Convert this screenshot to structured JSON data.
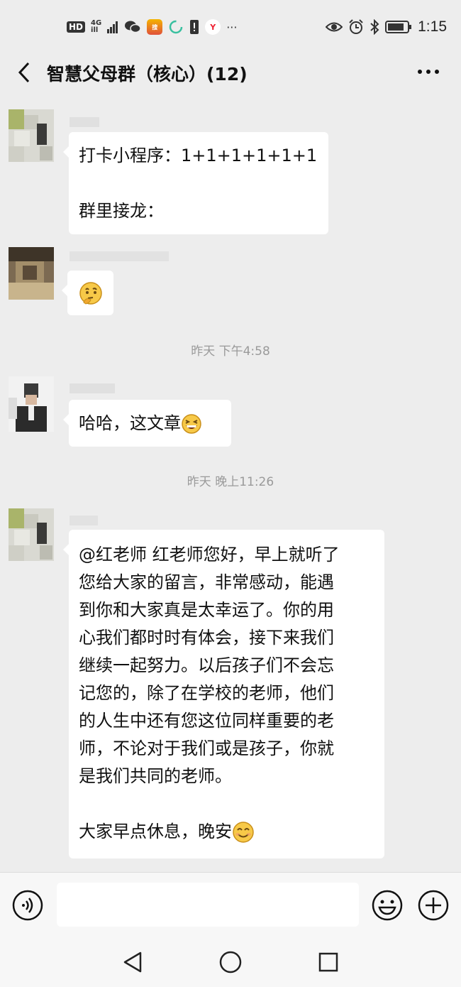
{
  "status_bar": {
    "hd": "HD",
    "network": "4G",
    "network_sub": "ill",
    "more": "···",
    "time": "1:15",
    "icons": [
      "hd-icon",
      "signal-icon",
      "wechat-icon",
      "sohu-app-icon",
      "spinner-app-icon",
      "alert-icon",
      "yidian-app-icon",
      "eye-icon",
      "alarm-icon",
      "bluetooth-icon",
      "battery-icon"
    ]
  },
  "header": {
    "title": "智慧父母群（核心）(12)",
    "back_icon": "chevron-left-icon",
    "more_icon": "more-dots-icon"
  },
  "messages": [
    {
      "type": "text",
      "lines": [
        "打卡小程序：1+1+1+1+1+1",
        "",
        "群里接龙："
      ]
    },
    {
      "type": "emoji",
      "emoji": "thinking-face"
    },
    {
      "type": "timestamp",
      "text": "昨天 下午4:58"
    },
    {
      "type": "text",
      "text": "哈哈，这文章",
      "emoji": "grinning-squint-face"
    },
    {
      "type": "timestamp",
      "text": "昨天 晚上11:26"
    },
    {
      "type": "text",
      "lines": [
        "@红老师  红老师您好，早上就听了",
        "您给大家的留言，非常感动，能遇",
        "到你和大家真是太幸运了。你的用",
        "心我们都时时有体会，接下来我们",
        "继续一起努力。以后孩子们不会忘",
        "记您的，除了在学校的老师，他们",
        "的人生中还有您这位同样重要的老",
        "师，不论对于我们或是孩子，你就",
        "是我们共同的老师。",
        "",
        "大家早点休息，晚安"
      ],
      "emoji": "smiling-face"
    }
  ],
  "input_bar": {
    "value": "",
    "voice_icon": "voice-icon",
    "emoji_icon": "emoji-icon",
    "plus_icon": "plus-circle-icon"
  },
  "nav_bar": {
    "icons": [
      "nav-back-icon",
      "nav-home-icon",
      "nav-recents-icon"
    ]
  }
}
